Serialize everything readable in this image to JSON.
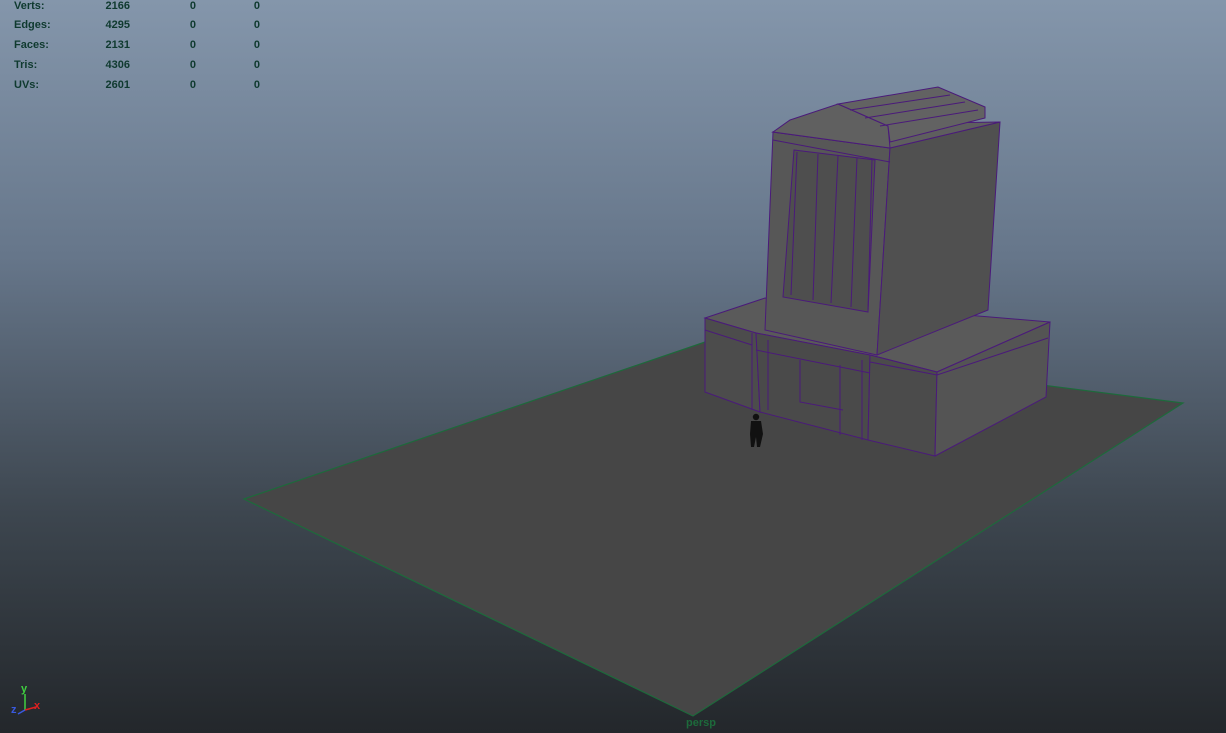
{
  "heads_up_display": {
    "rows": [
      {
        "label": "Verts:",
        "v1": "2166",
        "v2": "0",
        "v3": "0"
      },
      {
        "label": "Edges:",
        "v1": "4295",
        "v2": "0",
        "v3": "0"
      },
      {
        "label": "Faces:",
        "v1": "2131",
        "v2": "0",
        "v3": "0"
      },
      {
        "label": "Tris:",
        "v1": "4306",
        "v2": "0",
        "v3": "0"
      },
      {
        "label": "UVs:",
        "v1": "2601",
        "v2": "0",
        "v3": "0"
      }
    ]
  },
  "camera": {
    "name": "persp"
  },
  "axes": {
    "x": "x",
    "y": "y",
    "z": "z"
  },
  "colors": {
    "wireframe": "#4a1a7a",
    "ground_edge": "#1d6a3b",
    "hud_text": "#0f3a2f",
    "axis_x": "#e02020",
    "axis_y": "#40d040",
    "axis_z": "#3a5ae0"
  }
}
